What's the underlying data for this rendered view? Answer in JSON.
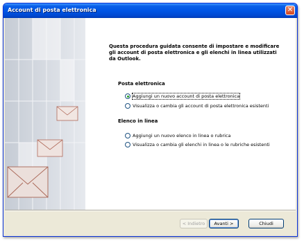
{
  "window": {
    "title": "Account di posta elettronica"
  },
  "intro": "Questa procedura guidata consente di impostare e modificare gli account di posta elettronica e gli elenchi in linea utilizzati da Outlook.",
  "email_section": {
    "heading": "Posta elettronica",
    "options": [
      {
        "label": "Aggiungi un nuovo account di posta elettronica",
        "checked": true
      },
      {
        "label": "Visualizza o cambia gli account di posta elettronica esistenti",
        "checked": false
      }
    ]
  },
  "directory_section": {
    "heading": "Elenco in linea",
    "options": [
      {
        "label": "Aggiungi un nuovo elenco in linea o rubrica",
        "checked": false
      },
      {
        "label": "Visualizza o cambia gli elenchi in linea o le rubriche esistenti",
        "checked": false
      }
    ]
  },
  "buttons": {
    "back": "< Indietro",
    "next": "Avanti >",
    "close": "Chiudi"
  },
  "icons": {
    "close": "close-icon"
  },
  "colors": {
    "titlebar": "#0055e5",
    "window_bg": "#ece9d8"
  }
}
